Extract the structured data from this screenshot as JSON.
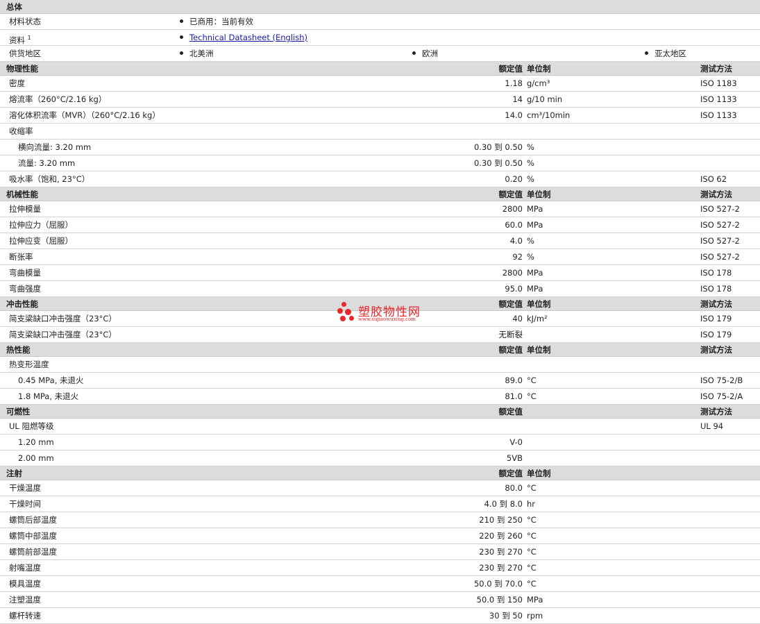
{
  "general": {
    "title": "总体",
    "rows": [
      {
        "label": "材料状态",
        "items": [
          "已商用：当前有效"
        ]
      },
      {
        "label": "资料",
        "sup": "1",
        "link": "Technical Datasheet (English)"
      },
      {
        "label": "供货地区",
        "items": [
          "北美洲",
          "欧洲",
          "亚太地区"
        ]
      }
    ]
  },
  "headers": {
    "value": "额定值",
    "unit": "单位制",
    "test": "测试方法"
  },
  "sections": [
    {
      "title": "物理性能",
      "show_unit": true,
      "show_test": true,
      "rows": [
        {
          "name": "密度",
          "value": "1.18",
          "unit": "g/cm³",
          "test": "ISO 1183"
        },
        {
          "name": "熔流率（260°C/2.16 kg）",
          "value": "14",
          "unit": "g/10 min",
          "test": "ISO 1133"
        },
        {
          "name": "溶化体积流率（MVR）（260°C/2.16 kg）",
          "value": "14.0",
          "unit": "cm³/10min",
          "test": "ISO 1133"
        },
        {
          "name": "收缩率",
          "value": "",
          "unit": "",
          "test": ""
        },
        {
          "name": "横向流量: 3.20 mm",
          "sub": true,
          "value": "0.30 到  0.50",
          "unit": "%",
          "test": ""
        },
        {
          "name": "流量: 3.20 mm",
          "sub": true,
          "value": "0.30 到  0.50",
          "unit": "%",
          "test": ""
        },
        {
          "name": "吸水率（饱和, 23°C）",
          "value": "0.20",
          "unit": "%",
          "test": "ISO 62"
        }
      ]
    },
    {
      "title": "机械性能",
      "show_unit": true,
      "show_test": true,
      "rows": [
        {
          "name": "拉伸模量",
          "value": "2800",
          "unit": "MPa",
          "test": "ISO 527-2"
        },
        {
          "name": "拉伸应力（屈服）",
          "value": "60.0",
          "unit": "MPa",
          "test": "ISO 527-2"
        },
        {
          "name": "拉伸应变（屈服）",
          "value": "4.0",
          "unit": "%",
          "test": "ISO 527-2"
        },
        {
          "name": "断张率",
          "value": "92",
          "unit": "%",
          "test": "ISO 527-2"
        },
        {
          "name": "弯曲模量",
          "value": "2800",
          "unit": "MPa",
          "test": "ISO 178"
        },
        {
          "name": "弯曲强度",
          "value": "95.0",
          "unit": "MPa",
          "test": "ISO 178"
        }
      ]
    },
    {
      "title": "冲击性能",
      "show_unit": true,
      "show_test": true,
      "rows": [
        {
          "name": "简支梁缺口冲击强度（23°C）",
          "value": "40",
          "unit": "kJ/m²",
          "test": "ISO 179"
        },
        {
          "name": "简支梁缺口冲击强度（23°C）",
          "value": "无断裂",
          "unit": "",
          "test": "ISO 179"
        }
      ]
    },
    {
      "title": "热性能",
      "show_unit": true,
      "show_test": true,
      "rows": [
        {
          "name": "热变形温度",
          "value": "",
          "unit": "",
          "test": ""
        },
        {
          "name": "0.45 MPa, 未退火",
          "sub": true,
          "value": "89.0",
          "unit": "°C",
          "test": "ISO 75-2/B"
        },
        {
          "name": "1.8 MPa, 未退火",
          "sub": true,
          "value": "81.0",
          "unit": "°C",
          "test": "ISO 75-2/A"
        }
      ]
    },
    {
      "title": "可燃性",
      "show_unit": false,
      "show_test": true,
      "rows": [
        {
          "name": "UL 阻燃等级",
          "value": "",
          "unit": "",
          "test": "UL 94"
        },
        {
          "name": "1.20 mm",
          "sub": true,
          "value": "V-0",
          "unit": "",
          "test": ""
        },
        {
          "name": "2.00 mm",
          "sub": true,
          "value": "5VB",
          "unit": "",
          "test": ""
        }
      ]
    },
    {
      "title": "注射",
      "show_unit": true,
      "show_test": false,
      "rows": [
        {
          "name": "干燥温度",
          "value": "80.0",
          "unit": "°C",
          "test": ""
        },
        {
          "name": "干燥时间",
          "value": "4.0 到  8.0",
          "unit": "hr",
          "test": ""
        },
        {
          "name": "螺筒后部温度",
          "value": "210 到  250",
          "unit": "°C",
          "test": ""
        },
        {
          "name": "螺筒中部温度",
          "value": "220 到  260",
          "unit": "°C",
          "test": ""
        },
        {
          "name": "螺筒前部温度",
          "value": "230 到  270",
          "unit": "°C",
          "test": ""
        },
        {
          "name": "射嘴温度",
          "value": "230 到  270",
          "unit": "°C",
          "test": ""
        },
        {
          "name": "模具温度",
          "value": "50.0 到  70.0",
          "unit": "°C",
          "test": ""
        },
        {
          "name": "注塑温度",
          "value": "50.0 到  150",
          "unit": "MPa",
          "test": ""
        },
        {
          "name": "螺杆转速",
          "value": "30 到  50",
          "unit": "rpm",
          "test": ""
        }
      ]
    }
  ],
  "watermark": {
    "name": "塑胶物性网",
    "url": "www.sujiaowuxing.com",
    "color": "#e8262b"
  }
}
